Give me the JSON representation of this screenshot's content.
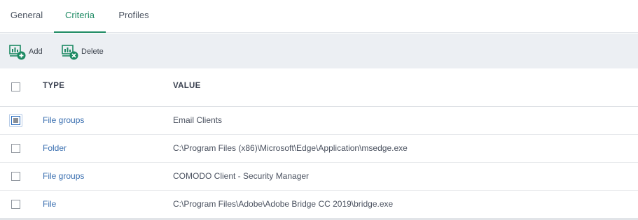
{
  "tabs": [
    {
      "label": "General"
    },
    {
      "label": "Criteria"
    },
    {
      "label": "Profiles"
    }
  ],
  "active_tab": "Criteria",
  "toolbar": {
    "add_label": "Add",
    "delete_label": "Delete"
  },
  "table": {
    "headers": {
      "type": "TYPE",
      "value": "VALUE"
    },
    "rows": [
      {
        "type": "File groups",
        "value": "Email Clients",
        "checked": "true"
      },
      {
        "type": "Folder",
        "value": "C:\\Program Files (x86)\\Microsoft\\Edge\\Application\\msedge.exe",
        "checked": "false"
      },
      {
        "type": "File groups",
        "value": "COMODO Client - Security Manager",
        "checked": "false"
      },
      {
        "type": "File",
        "value": "C:\\Program Files\\Adobe\\Adobe Bridge CC 2019\\bridge.exe",
        "checked": "false"
      }
    ]
  },
  "colors": {
    "accent": "#1d8a63",
    "link": "#3a6fb0",
    "toolbar_bg": "#eceff3"
  }
}
